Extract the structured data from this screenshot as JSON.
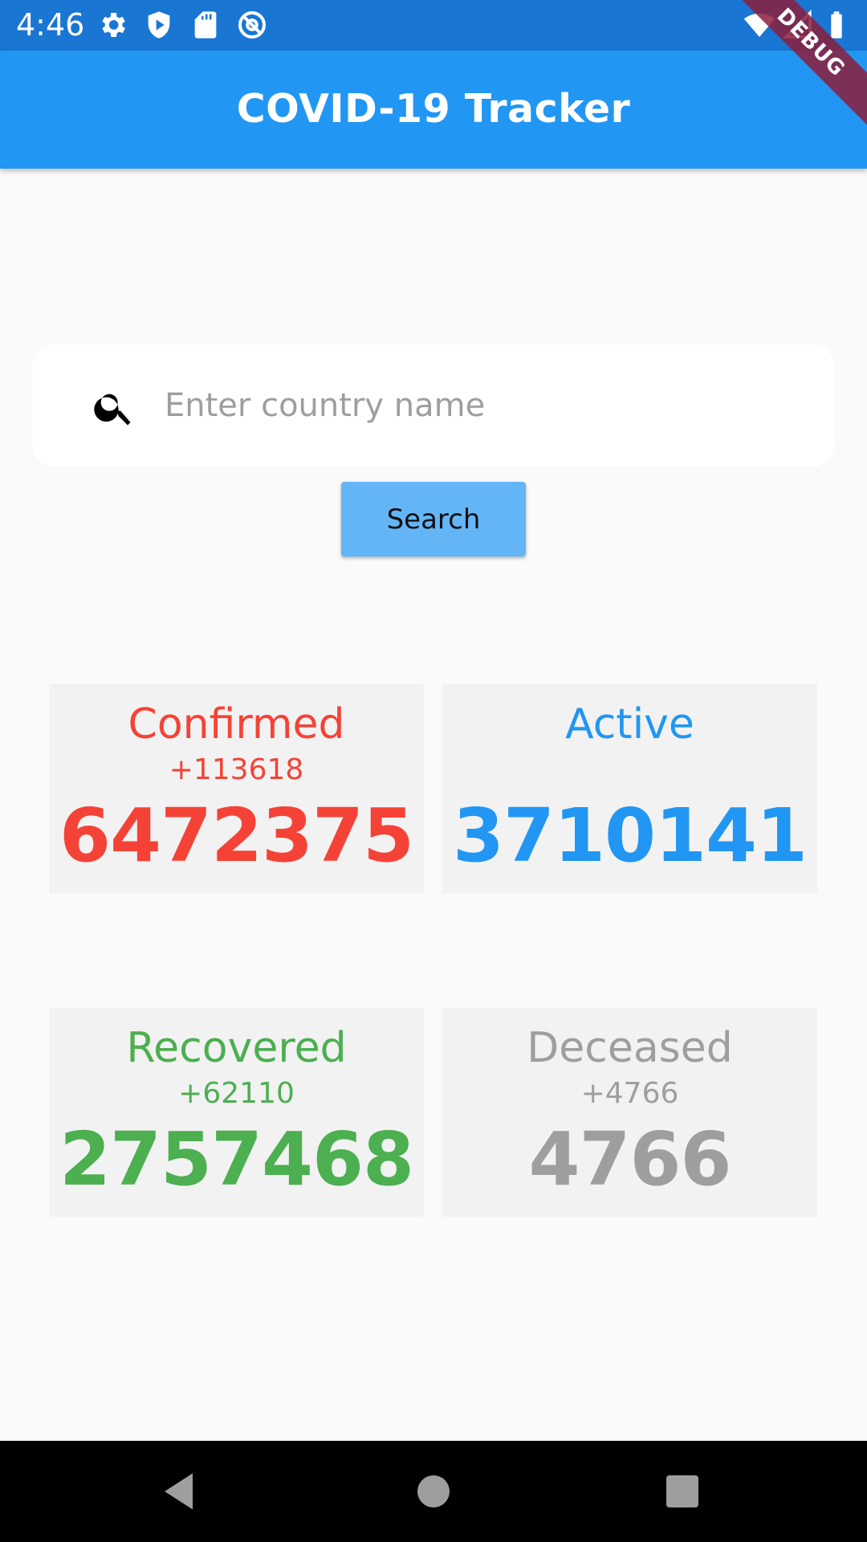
{
  "status_bar": {
    "time": "4:46",
    "left_icons": [
      "settings-icon",
      "shield-play-icon",
      "sd-card-icon",
      "at-sign-icon"
    ],
    "right_icons": [
      "wifi-icon",
      "cell-signal-icon",
      "battery-icon"
    ],
    "background": "#1976d2"
  },
  "debug_banner": "DEBUG",
  "app_bar": {
    "title": "COVID-19 Tracker",
    "background": "#2196f3"
  },
  "search": {
    "placeholder": "Enter country name",
    "value": "",
    "icon": "search-icon",
    "button_label": "Search",
    "button_color": "#64b5f6"
  },
  "stats": {
    "confirmed": {
      "label": "Confirmed",
      "delta": "+113618",
      "total": "6472375",
      "color": "#f44336"
    },
    "active": {
      "label": "Active",
      "delta": "",
      "total": "3710141",
      "color": "#2196f3"
    },
    "recovered": {
      "label": "Recovered",
      "delta": "+62110",
      "total": "2757468",
      "color": "#4caf50"
    },
    "deceased": {
      "label": "Deceased",
      "delta": "+4766",
      "total": "4766",
      "color": "#9e9e9e"
    }
  },
  "nav_bar": {
    "buttons": [
      "back-icon",
      "home-icon",
      "recents-icon"
    ]
  }
}
